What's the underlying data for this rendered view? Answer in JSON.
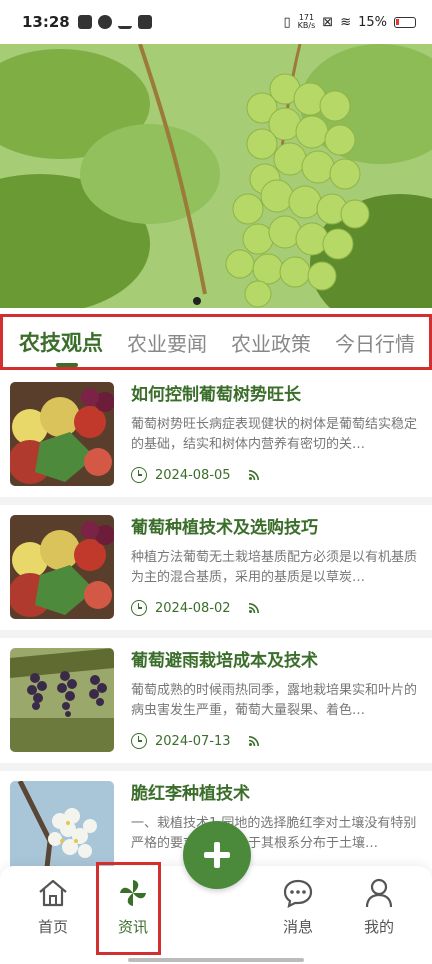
{
  "status_bar": {
    "time": "13:28",
    "net_speed": "171",
    "net_unit": "KB/s",
    "battery": "15%"
  },
  "tabs": [
    {
      "label": "农技观点",
      "active": true
    },
    {
      "label": "农业要闻",
      "active": false
    },
    {
      "label": "农业政策",
      "active": false
    },
    {
      "label": "今日行情",
      "active": false
    }
  ],
  "articles": [
    {
      "title": "如何控制葡萄树势旺长",
      "summary": "葡萄树势旺长病症表现健状的树体是葡萄结实稳定的基础，结实和树体内营养有密切的关…",
      "date": "2024-08-05",
      "thumb": "fruits"
    },
    {
      "title": "葡萄种植技术及选购技巧",
      "summary": "种植方法葡萄无土栽培基质配方必须是以有机基质为主的混合基质，采用的基质是以草炭…",
      "date": "2024-08-02",
      "thumb": "fruits"
    },
    {
      "title": "葡萄避雨栽培成本及技术",
      "summary": "葡萄成熟的时候雨热同季，露地栽培果实和叶片的病虫害发生严重，葡萄大量裂果、着色…",
      "date": "2024-07-13",
      "thumb": "grapes"
    },
    {
      "title": "脆红李种植技术",
      "summary": "一、栽植技术1.园地的选择脆红李对土壤没有特别严格的要求，但是由于其根系分布于土壤…",
      "date": "",
      "thumb": "blossom"
    }
  ],
  "bottom_nav": {
    "home": "首页",
    "news": "资讯",
    "messages": "消息",
    "mine": "我的"
  },
  "colors": {
    "accent": "#3b6e2b",
    "fab": "#4b8a3a",
    "highlight": "#d32f2f"
  }
}
